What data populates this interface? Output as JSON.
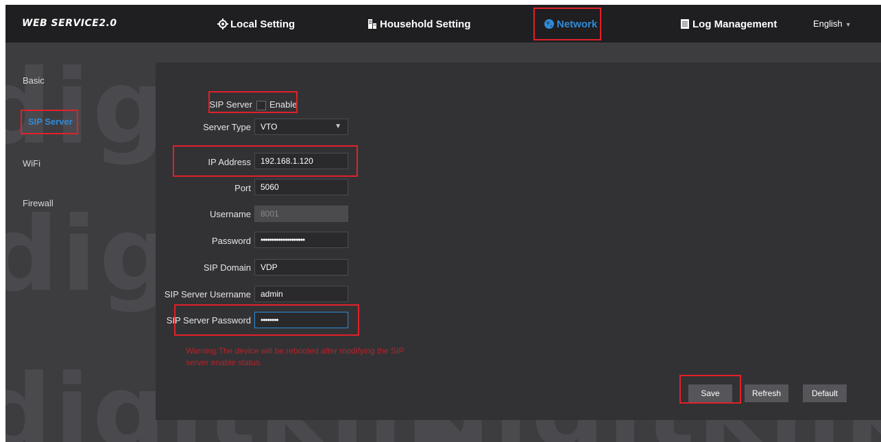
{
  "brand": "WEB SERVICE2.0",
  "nav": [
    {
      "label": "Local Setting",
      "icon": "gear-icon"
    },
    {
      "label": "Household Setting",
      "icon": "building-icon"
    },
    {
      "label": "Network",
      "icon": "globe-icon",
      "active": true
    },
    {
      "label": "Log Management",
      "icon": "document-icon"
    }
  ],
  "language": "English",
  "sidebar": [
    {
      "label": "Basic"
    },
    {
      "label": "SIP Server",
      "active": true
    },
    {
      "label": "WiFi"
    },
    {
      "label": "Firewall"
    }
  ],
  "watermark": "digitklik",
  "form": {
    "sip_server_label": "SIP Server",
    "enable_label": "Enable",
    "enable_checked": false,
    "server_type_label": "Server Type",
    "server_type_value": "VTO",
    "ip_address_label": "IP Address",
    "ip_address_value": "192.168.1.120",
    "port_label": "Port",
    "port_value": "5060",
    "username_label": "Username",
    "username_value": "8001",
    "password_label": "Password",
    "password_value": "••••••••••••••••••••",
    "sip_domain_label": "SIP Domain",
    "sip_domain_value": "VDP",
    "sip_server_username_label": "SIP Server Username",
    "sip_server_username_value": "admin",
    "sip_server_password_label": "SIP Server Password",
    "sip_server_password_value": "••••••••"
  },
  "warning": "Warning:The device will be rebooted after modifying the SIP server enable status.",
  "buttons": {
    "save": "Save",
    "refresh": "Refresh",
    "default": "Default"
  },
  "colors": {
    "highlight": "#e2202a",
    "accent": "#2f8bd8",
    "warning": "#b3242b"
  }
}
